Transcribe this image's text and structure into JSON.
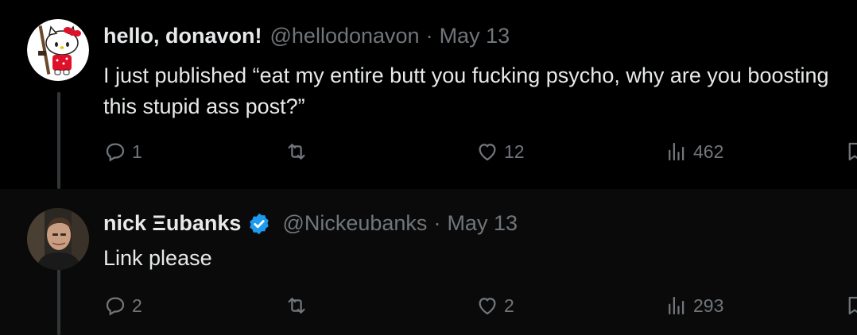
{
  "tweets": [
    {
      "display_name": "hello, donavon!",
      "handle": "@hellodonavon",
      "separator": "·",
      "date": "May 13",
      "text": "I just published “eat my entire butt you fucking psycho, why are you boosting this stupid ass post?”",
      "avatar_icon": "hello-kitty-avatar",
      "verified": false,
      "replies": "1",
      "retweets": "",
      "likes": "12",
      "views": "462"
    },
    {
      "display_name": "nick Ξubanks",
      "handle": "@Nickeubanks",
      "separator": "·",
      "date": "May 13",
      "text": "Link please",
      "avatar_icon": "profile-photo-avatar",
      "verified": true,
      "replies": "2",
      "retweets": "",
      "likes": "2",
      "views": "293"
    }
  ],
  "colors": {
    "background": "#000000",
    "text": "#e7e9ea",
    "muted": "#71767b",
    "verified_blue": "#1d9bf0"
  }
}
